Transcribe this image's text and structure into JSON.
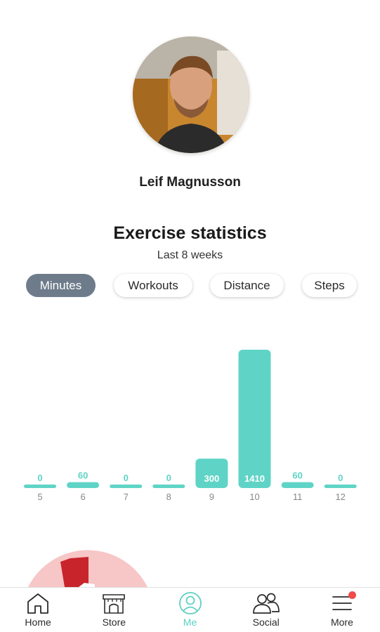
{
  "profile": {
    "name": "Leif Magnusson"
  },
  "stats": {
    "title": "Exercise statistics",
    "subtitle": "Last 8 weeks"
  },
  "tabs": [
    {
      "label": "Minutes",
      "active": true
    },
    {
      "label": "Workouts",
      "active": false
    },
    {
      "label": "Distance",
      "active": false
    },
    {
      "label": "Steps",
      "active": false
    }
  ],
  "chart_data": {
    "type": "bar",
    "categories": [
      "5",
      "6",
      "7",
      "8",
      "9",
      "10",
      "11",
      "12"
    ],
    "values": [
      0,
      60,
      0,
      0,
      300,
      1410,
      60,
      0
    ],
    "ylim": [
      0,
      1410
    ],
    "bar_color": "#5fd4c6",
    "grid": false
  },
  "nav": {
    "items": [
      {
        "label": "Home",
        "icon": "home-icon",
        "active": false
      },
      {
        "label": "Store",
        "icon": "store-icon",
        "active": false
      },
      {
        "label": "Me",
        "icon": "user-icon",
        "active": true
      },
      {
        "label": "Social",
        "icon": "people-icon",
        "active": false
      },
      {
        "label": "More",
        "icon": "menu-icon",
        "active": false,
        "notification": true
      }
    ]
  },
  "colors": {
    "accent": "#5fd0c3",
    "tab_active_bg": "#6e7b8a",
    "badge": "#f04b4b"
  }
}
